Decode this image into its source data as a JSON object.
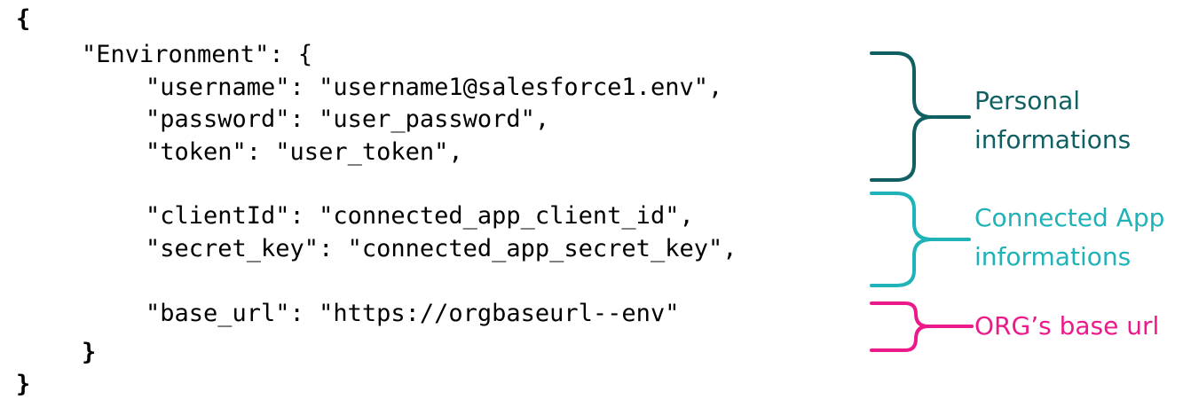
{
  "code": {
    "open_brace": "{",
    "env_line": "\"Environment\": {",
    "username_line": "\"username\": \"username1@salesforce1.env\",",
    "password_line": "\"password\": \"user_password\",",
    "token_line": "\"token\": \"user_token\",",
    "clientid_line": "\"clientId\": \"connected_app_client_id\",",
    "secret_line": "\"secret_key\": \"connected_app_secret_key\",",
    "baseurl_line": "\"base_url\": \"https://orgbaseurl--env\"",
    "inner_close": "}",
    "outer_close": "}"
  },
  "annotations": {
    "personal": {
      "line1": "Personal",
      "line2": "informations",
      "color": "#0f5f63"
    },
    "connected_app": {
      "line1": "Connected App",
      "line2": "informations",
      "color": "#1fb2b8"
    },
    "org_base_url": {
      "label": "ORG’s base url",
      "color": "#ec198a"
    }
  }
}
